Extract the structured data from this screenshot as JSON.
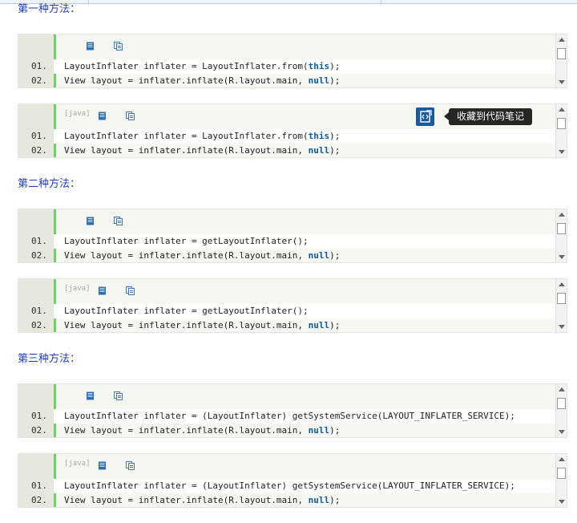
{
  "sections": [
    {
      "heading": "第一种方法：",
      "blocks": [
        {
          "lang": "",
          "lines": [
            {
              "num": "01.",
              "pre": "LayoutInflater inflater = LayoutInflater.from(",
              "kw": "this",
              "post": ");"
            },
            {
              "num": "02.",
              "pre": "View layout = inflater.inflate(R.layout.main, ",
              "kw": "null",
              "post": ");"
            }
          ]
        },
        {
          "lang": "[java]",
          "lines": [
            {
              "num": "01.",
              "pre": "LayoutInflater inflater = LayoutInflater.from(",
              "kw": "this",
              "post": ");"
            },
            {
              "num": "02.",
              "pre": "View layout = inflater.inflate(R.layout.main, ",
              "kw": "null",
              "post": ");"
            }
          ]
        }
      ]
    },
    {
      "heading": "第二种方法：",
      "blocks": [
        {
          "lang": "",
          "lines": [
            {
              "num": "01.",
              "pre": "LayoutInflater inflater = getLayoutInflater();",
              "kw": "",
              "post": ""
            },
            {
              "num": "02.",
              "pre": "View layout = inflater.inflate(R.layout.main, ",
              "kw": "null",
              "post": ");"
            }
          ]
        },
        {
          "lang": "[java]",
          "lines": [
            {
              "num": "01.",
              "pre": "LayoutInflater inflater = getLayoutInflater();",
              "kw": "",
              "post": ""
            },
            {
              "num": "02.",
              "pre": "View layout = inflater.inflate(R.layout.main, ",
              "kw": "null",
              "post": ");"
            }
          ]
        }
      ]
    },
    {
      "heading": "第三种方法：",
      "blocks": [
        {
          "lang": "",
          "lines": [
            {
              "num": "01.",
              "pre": "LayoutInflater inflater = (LayoutInflater) getSystemService(LAYOUT_INFLATER_SERVICE);",
              "kw": "",
              "post": ""
            },
            {
              "num": "02.",
              "pre": "View layout = inflater.inflate(R.layout.main, ",
              "kw": "null",
              "post": ");"
            }
          ]
        },
        {
          "lang": "[java]",
          "lines": [
            {
              "num": "01.",
              "pre": "LayoutInflater inflater = (LayoutInflater) getSystemService(LAYOUT_INFLATER_SERVICE);",
              "kw": "",
              "post": ""
            },
            {
              "num": "02.",
              "pre": "View layout = inflater.inflate(R.layout.main, ",
              "kw": "null",
              "post": ");"
            }
          ]
        }
      ]
    }
  ],
  "toolbar_icons": [
    "view-plain-icon",
    "copy-icon"
  ],
  "tooltip": {
    "label": "收藏到代码笔记",
    "icon": "save-snippet-icon"
  },
  "colors": {
    "heading": "#1f3fbf",
    "keyword": "#0a5aa0",
    "accent_bar": "#6ccf63",
    "gutter": "#e7e6df",
    "favorite_button": "#1a5a9e"
  }
}
